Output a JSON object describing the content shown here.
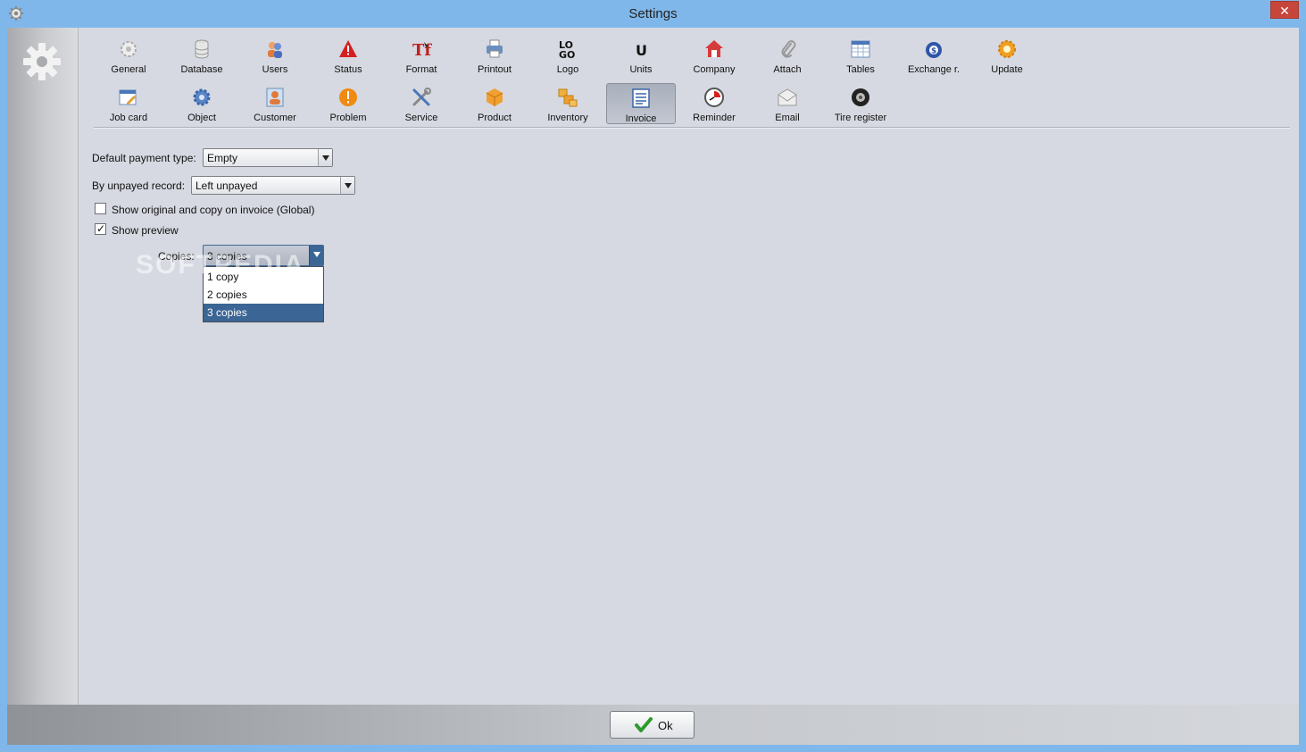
{
  "window": {
    "title": "Settings",
    "close_glyph": "✕"
  },
  "toolbar": {
    "row1": [
      {
        "id": "general",
        "label": "General",
        "icon": "gear-icon"
      },
      {
        "id": "database",
        "label": "Database",
        "icon": "database-icon"
      },
      {
        "id": "users",
        "label": "Users",
        "icon": "users-icon"
      },
      {
        "id": "status",
        "label": "Status",
        "icon": "warning-icon"
      },
      {
        "id": "format",
        "label": "Format",
        "icon": "format-icon"
      },
      {
        "id": "printout",
        "label": "Printout",
        "icon": "printer-icon"
      },
      {
        "id": "logo",
        "label": "Logo",
        "icon": "logo-icon"
      },
      {
        "id": "units",
        "label": "Units",
        "icon": "units-icon"
      },
      {
        "id": "company",
        "label": "Company",
        "icon": "house-icon"
      },
      {
        "id": "attach",
        "label": "Attach",
        "icon": "paperclip-icon"
      },
      {
        "id": "tables",
        "label": "Tables",
        "icon": "table-icon"
      },
      {
        "id": "exchange",
        "label": "Exchange r.",
        "icon": "money-bag-icon"
      },
      {
        "id": "update",
        "label": "Update",
        "icon": "update-icon"
      }
    ],
    "row2": [
      {
        "id": "job-card",
        "label": "Job card",
        "icon": "job-card-icon"
      },
      {
        "id": "object",
        "label": "Object",
        "icon": "cog-blue-icon"
      },
      {
        "id": "customer",
        "label": "Customer",
        "icon": "customer-icon"
      },
      {
        "id": "problem",
        "label": "Problem",
        "icon": "exclamation-icon"
      },
      {
        "id": "service",
        "label": "Service",
        "icon": "tools-icon"
      },
      {
        "id": "product",
        "label": "Product",
        "icon": "box-icon"
      },
      {
        "id": "inventory",
        "label": "Inventory",
        "icon": "boxes-icon"
      },
      {
        "id": "invoice",
        "label": "Invoice",
        "icon": "invoice-icon",
        "active": true
      },
      {
        "id": "reminder",
        "label": "Reminder",
        "icon": "clock-icon"
      },
      {
        "id": "email",
        "label": "Email",
        "icon": "envelope-icon"
      },
      {
        "id": "tire-register",
        "label": "Tire register",
        "icon": "tire-icon"
      }
    ]
  },
  "form": {
    "payment_type_label": "Default payment type:",
    "payment_type_value": "Empty",
    "unpayed_label": "By unpayed record:",
    "unpayed_value": "Left unpayed",
    "show_original_label": "Show original and copy on invoice (Global)",
    "show_original_checked": false,
    "show_preview_label": "Show preview",
    "show_preview_checked": true,
    "copies_label": "Copies:",
    "copies_value": "3 copies",
    "copies_options": [
      "1 copy",
      "2 copies",
      "3 copies"
    ],
    "copies_selected_index": 2
  },
  "watermark": "SOFTPEDIA",
  "footer": {
    "ok_label": "Ok"
  },
  "colors": {
    "titlebar": "#7fb7ea",
    "client": "#d6d9e1",
    "selection": "#3a6594",
    "close": "#c7463c"
  }
}
